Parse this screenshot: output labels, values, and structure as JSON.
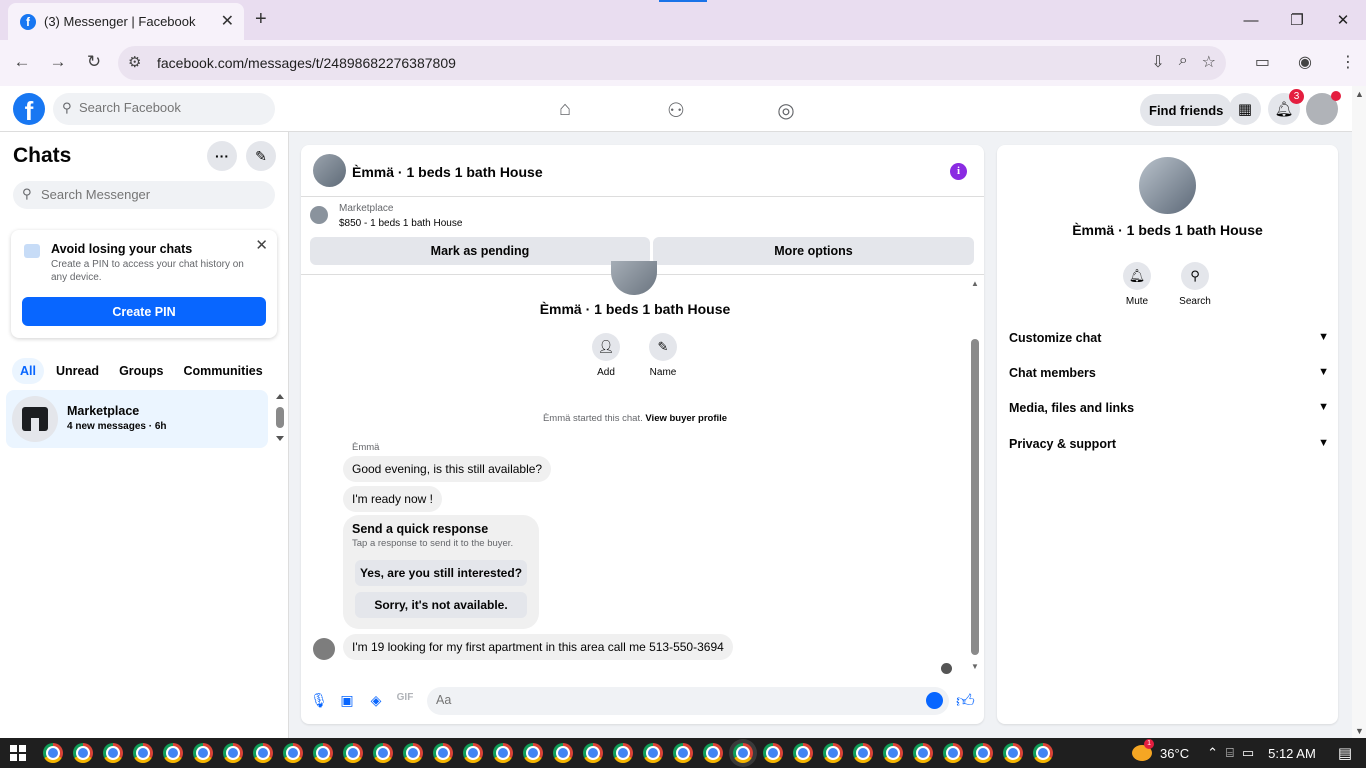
{
  "browser": {
    "tab_title": "(3) Messenger | Facebook",
    "url": "facebook.com/messages/t/24898682276387809"
  },
  "header": {
    "search_placeholder": "Search Facebook",
    "find_friends": "Find friends",
    "notification_count": "3"
  },
  "sidebar": {
    "title": "Chats",
    "search_placeholder": "Search Messenger",
    "pin_card": {
      "title": "Avoid losing your chats",
      "description": "Create a PIN to access your chat history on any device.",
      "button": "Create PIN"
    },
    "filters": [
      "All",
      "Unread",
      "Groups",
      "Communities"
    ],
    "conversation": {
      "name": "Marketplace",
      "meta": "4 new messages · 6h"
    }
  },
  "chat": {
    "title": "Èmmä · 1 beds 1 bath House",
    "marketplace_label": "Marketplace",
    "listing": "$850 - 1 beds 1 bath House",
    "mark_pending": "Mark as pending",
    "more_options": "More options",
    "contact_name": "Èmmä · 1 beds 1 bath House",
    "actions": {
      "add": "Add",
      "name": "Name"
    },
    "started_text": "Èmmä started this chat.",
    "view_profile": "View buyer profile",
    "sender": "Èmmä",
    "messages": [
      "Good evening, is this still available?",
      "I'm ready now !"
    ],
    "quick_response": {
      "title": "Send a quick response",
      "subtitle": "Tap a response to send it to the buyer.",
      "options": [
        "Yes, are you still interested?",
        "Sorry, it's not available."
      ]
    },
    "last_message": "I'm 19 looking for my first apartment in this area call me 513-550-3694",
    "composer_placeholder": "Aa"
  },
  "details": {
    "name": "Èmmä · 1 beds 1 bath House",
    "actions": {
      "mute": "Mute",
      "search": "Search"
    },
    "sections": [
      "Customize chat",
      "Chat members",
      "Media, files and links",
      "Privacy & support"
    ]
  },
  "taskbar": {
    "temperature": "36°C",
    "time": "5:12 AM",
    "weather_badge": "1"
  },
  "colors": {
    "accent": "#0866ff",
    "facebook_blue": "#1877f2",
    "notification_red": "#e41e3f",
    "info_purple": "#8a2be2"
  }
}
